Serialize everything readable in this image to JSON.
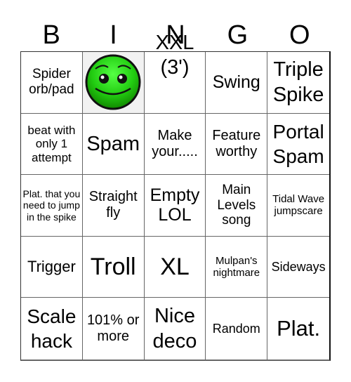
{
  "header": [
    "B",
    "I",
    "N",
    "G",
    "O"
  ],
  "free_space": {
    "icon": "green-smiley-face-icon",
    "colors": {
      "face": "#33dd22",
      "shade": "#118800",
      "outline": "#111111"
    }
  },
  "cells": [
    "Spider orb/pad",
    "",
    "XXL (3')",
    "Swing",
    "Triple Spike",
    "beat with only 1 attempt",
    "Spam",
    "Make your.....",
    "Feature worthy",
    "Portal Spam",
    "Plat. that you need to jump in the spike",
    "Straight fly",
    "Empty LOL",
    "Main Levels song",
    "Tidal Wave jumpscare",
    "Trigger",
    "Troll",
    "XL",
    "Mulpan's nightmare",
    "Sideways",
    "Scale hack",
    "101% or more",
    "Nice deco",
    "Random",
    "Plat."
  ]
}
